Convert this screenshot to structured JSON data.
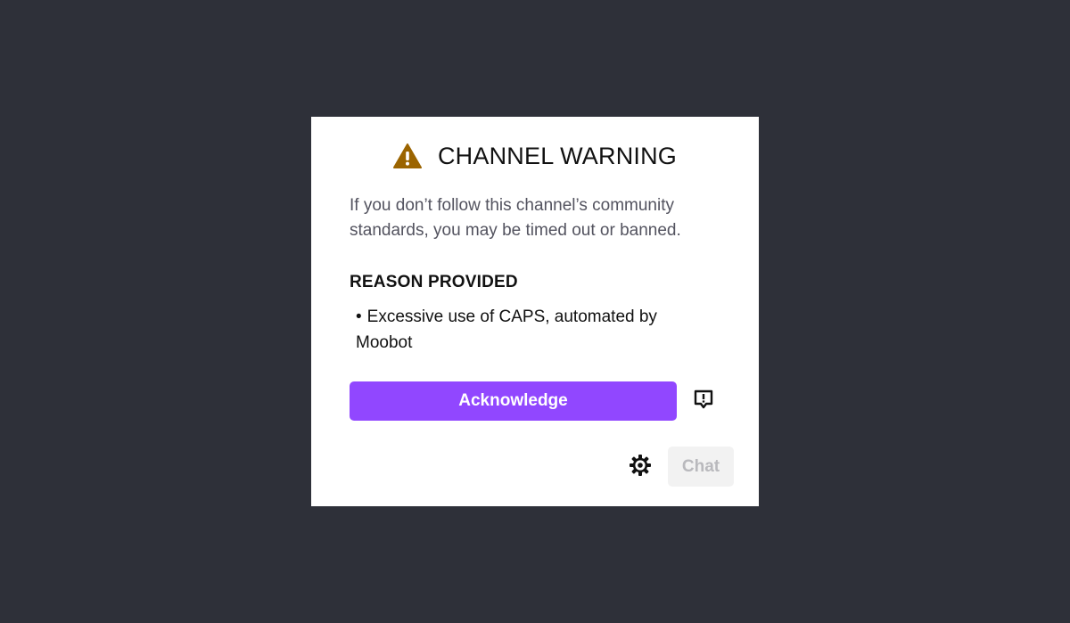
{
  "modal": {
    "title": "CHANNEL WARNING",
    "description": "If you don’t follow this channel’s community standards, you may be timed out or banned.",
    "reason_heading": "REASON PROVIDED",
    "reasons": [
      "Excessive use of CAPS, automated by Moobot"
    ],
    "acknowledge_label": "Acknowledge",
    "chat_label": "Chat"
  },
  "icons": {
    "warning": "warning-triangle-icon",
    "report": "report-flag-icon",
    "settings": "gear-icon"
  },
  "colors": {
    "page_background": "#2e3039",
    "modal_background": "#ffffff",
    "accent": "#9147ff",
    "warning": "#9b6400",
    "chat_button_background": "#f2f2f2",
    "chat_button_text": "#b9b9bd"
  }
}
